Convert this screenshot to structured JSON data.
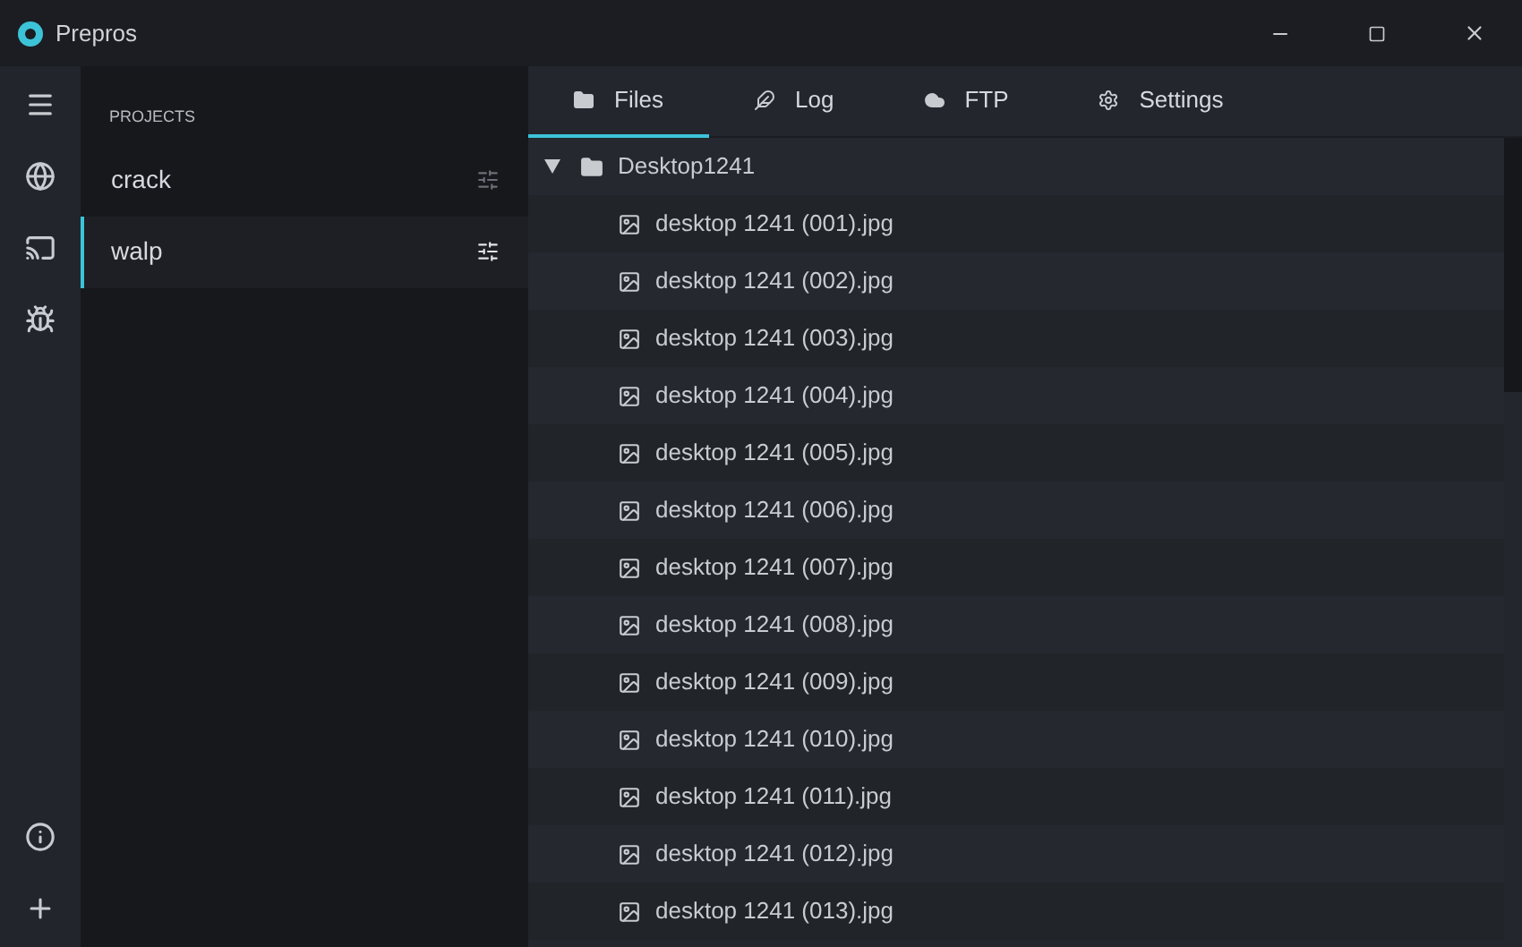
{
  "window": {
    "title": "Prepros"
  },
  "sidebar": {
    "items": [
      {
        "kind": "menu"
      },
      {
        "kind": "globe"
      },
      {
        "kind": "cast"
      },
      {
        "kind": "bug"
      }
    ],
    "bottom_items": [
      {
        "kind": "info"
      },
      {
        "kind": "add"
      }
    ]
  },
  "projects": {
    "heading": "PROJECTS",
    "items": [
      {
        "name": "crack",
        "selected": false
      },
      {
        "name": "walp",
        "selected": true
      }
    ]
  },
  "tabs": [
    {
      "label": "Files",
      "kind": "folder",
      "selected": true
    },
    {
      "label": "Log",
      "kind": "feather",
      "selected": false
    },
    {
      "label": "FTP",
      "kind": "cloud",
      "selected": false
    },
    {
      "label": "Settings",
      "kind": "gear",
      "selected": false
    }
  ],
  "tree": [
    {
      "label": "Desktop1241",
      "kind": "folder",
      "expanded": true,
      "children": [
        {
          "label": "desktop 1241 (001).jpg",
          "kind": "image"
        },
        {
          "label": "desktop 1241 (002).jpg",
          "kind": "image"
        },
        {
          "label": "desktop 1241 (003).jpg",
          "kind": "image"
        },
        {
          "label": "desktop 1241 (004).jpg",
          "kind": "image"
        },
        {
          "label": "desktop 1241 (005).jpg",
          "kind": "image"
        },
        {
          "label": "desktop 1241 (006).jpg",
          "kind": "image"
        },
        {
          "label": "desktop 1241 (007).jpg",
          "kind": "image"
        },
        {
          "label": "desktop 1241 (008).jpg",
          "kind": "image"
        },
        {
          "label": "desktop 1241 (009).jpg",
          "kind": "image"
        },
        {
          "label": "desktop 1241 (010).jpg",
          "kind": "image"
        },
        {
          "label": "desktop 1241 (011).jpg",
          "kind": "image"
        },
        {
          "label": "desktop 1241 (012).jpg",
          "kind": "image"
        },
        {
          "label": "desktop 1241 (013).jpg",
          "kind": "image"
        }
      ]
    }
  ]
}
